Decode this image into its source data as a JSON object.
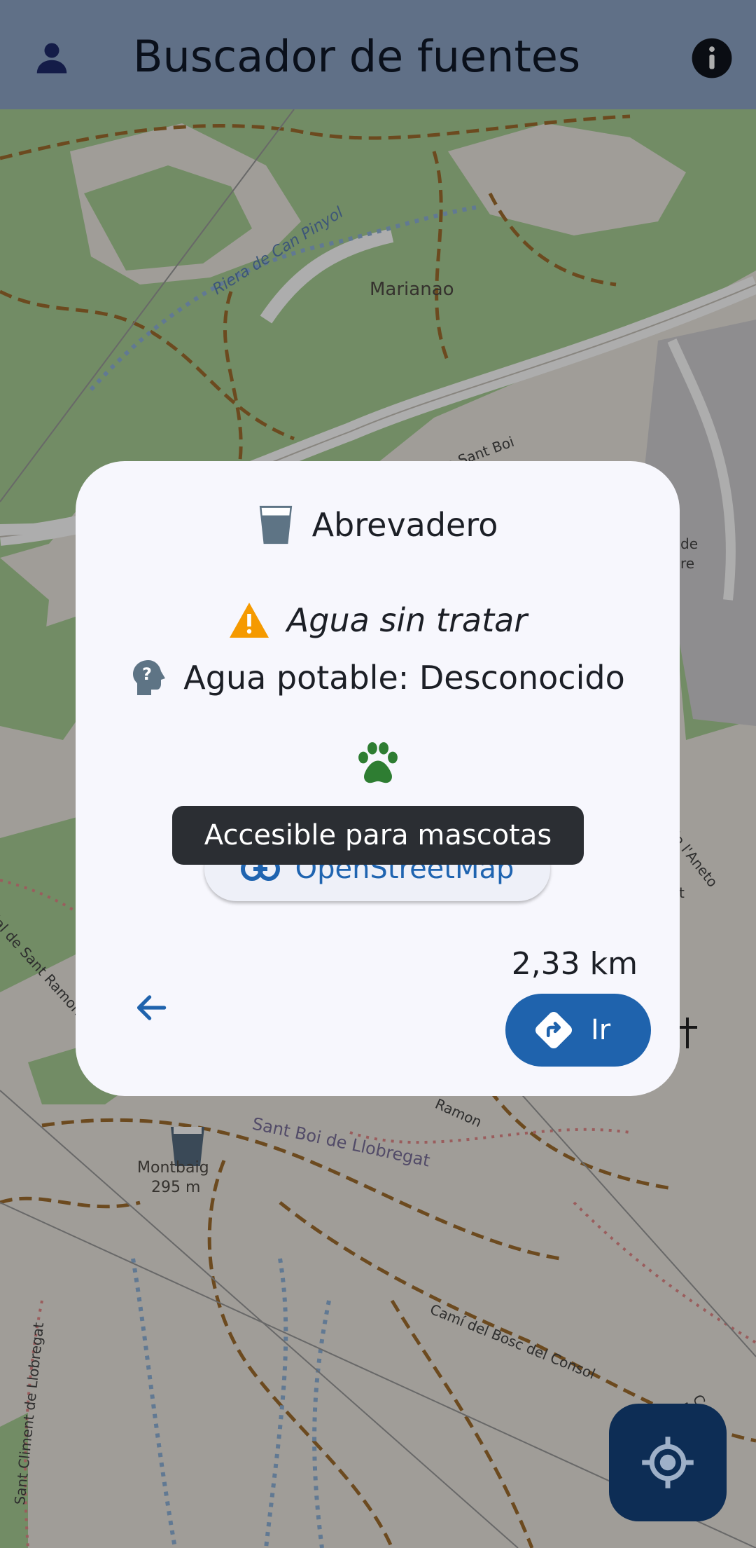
{
  "appbar": {
    "title": "Buscador de fuentes",
    "account_icon": "account-icon",
    "info_icon": "info-icon"
  },
  "map": {
    "labels": {
      "riera": "Riera de Can Pinyol",
      "marianao": "Marianao",
      "carretera": "rretera de Sant Climent a Sant Boi",
      "sant_ramon": "dal de Sant Ramon",
      "montbaig": "Montbaig",
      "montbaig_alt": "295 m",
      "sant_boi": "Sant Boi de Llobregat",
      "ramon": "Ramon",
      "cami": "Camí del Bosc del Consol",
      "sant_climent": "Sant Climent de Llobregat",
      "aneto": "de l'Aneto",
      "camps": "Camps Bla",
      "de_re": "de",
      "re": "re",
      "t": "t"
    }
  },
  "dialog": {
    "type_label": "Abrevadero",
    "warning_label": "Agua sin tratar",
    "potable_label": "Agua potable: Desconocido",
    "osm_label": "OpenStreetMap",
    "tooltip": "Accesible para mascotas",
    "distance": "2,33 km",
    "go_label": "Ir"
  },
  "colors": {
    "appbar": "#8ea5c8",
    "primary": "#1f63ad",
    "warning": "#f59a00",
    "pet": "#2e7d32",
    "fab": "#0d2d55"
  }
}
